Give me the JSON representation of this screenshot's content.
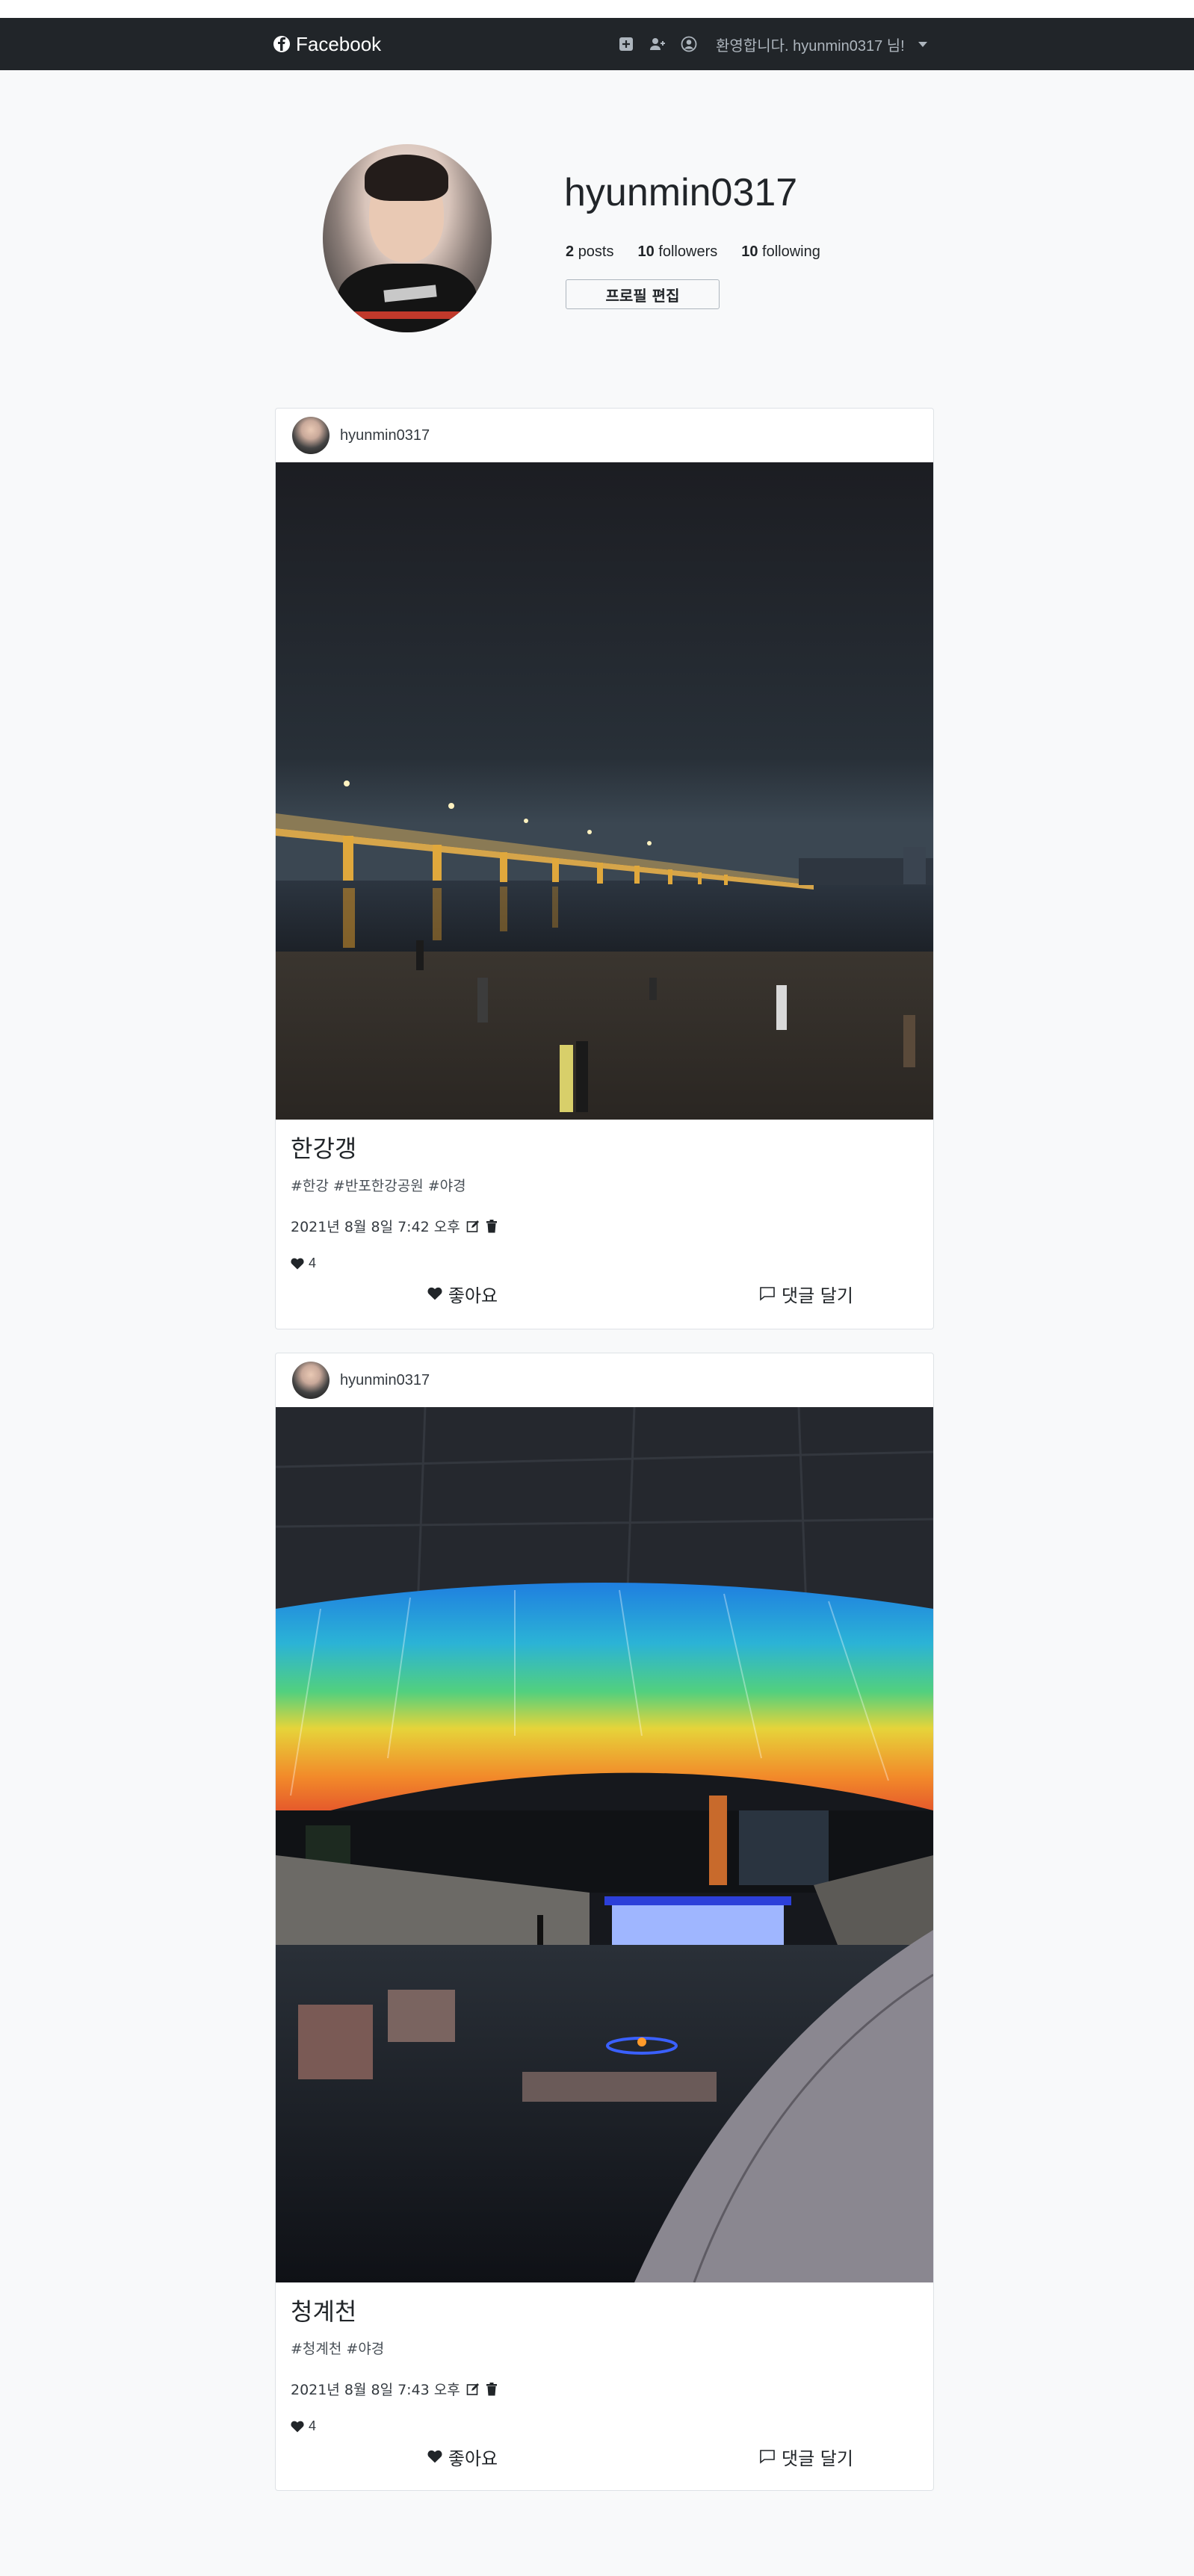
{
  "navbar": {
    "brand": "Facebook",
    "greeting": "환영합니다. hyunmin0317 님!",
    "icons": [
      "plus-square-icon",
      "person-plus-icon",
      "person-circle-icon",
      "caret-down-icon"
    ],
    "background": "#212529"
  },
  "profile": {
    "username": "hyunmin0317",
    "posts_count": "2",
    "posts_label": "posts",
    "followers_count": "10",
    "followers_label": "followers",
    "following_count": "10",
    "following_label": "following",
    "edit_button": "프로필 편집"
  },
  "posts": [
    {
      "author": "hyunmin0317",
      "title": "한강갱",
      "tags": "#한강 #반포한강공원 #야경",
      "date": "2021년 8월 8일 7:42 오후",
      "likes": "4",
      "like_label": "좋아요",
      "comment_label": "댓글 달기",
      "image_desc_icon": "photo-icon"
    },
    {
      "author": "hyunmin0317",
      "title": "청계천",
      "tags": "#청계천 #야경",
      "date": "2021년 8월 8일 7:43 오후",
      "likes": "4",
      "like_label": "좋아요",
      "comment_label": "댓글 달기",
      "image_desc_icon": "photo-icon"
    }
  ]
}
